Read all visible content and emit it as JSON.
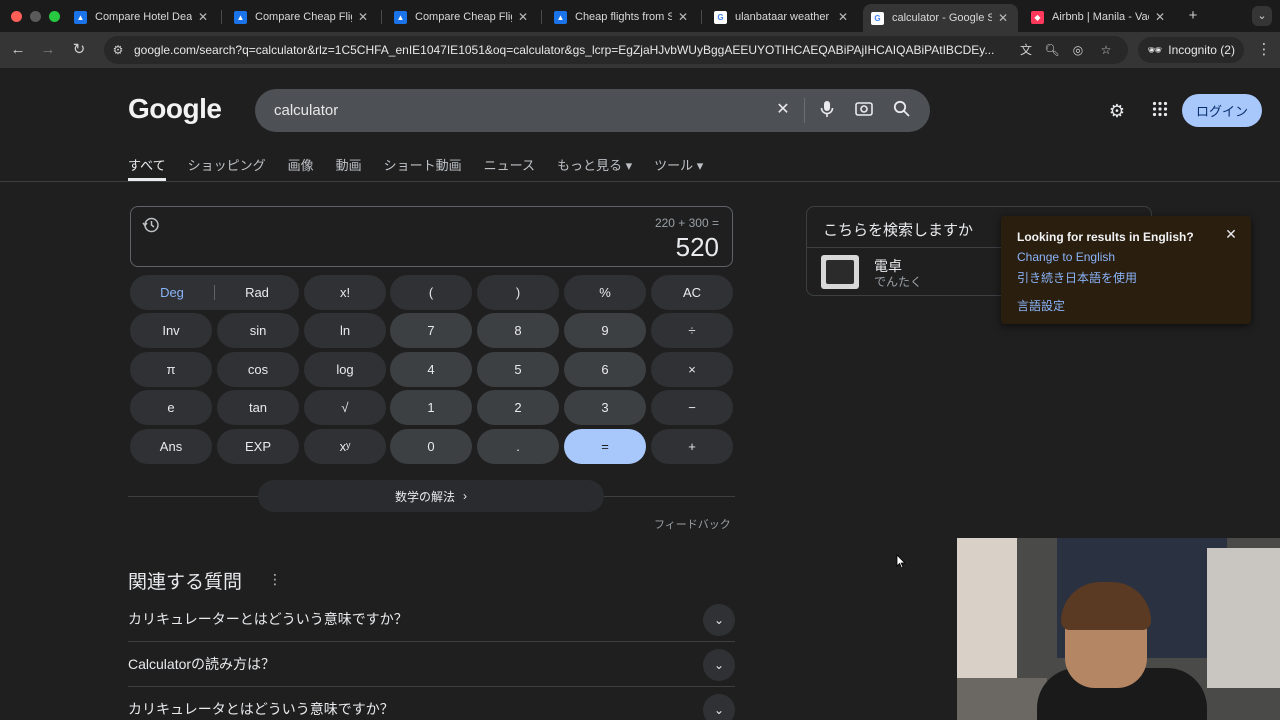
{
  "browser": {
    "tabs": [
      {
        "label": "Compare Hotel Deals",
        "icon": "kayak-icon",
        "color": "#1a73e8"
      },
      {
        "label": "Compare Cheap Flights",
        "icon": "kayak-icon",
        "color": "#1a73e8"
      },
      {
        "label": "Compare Cheap Flights",
        "icon": "kayak-icon",
        "color": "#1a73e8"
      },
      {
        "label": "Cheap flights from S",
        "icon": "kayak-icon",
        "color": "#1a73e8"
      },
      {
        "label": "ulanbataar weather -",
        "icon": "google-icon",
        "color": "#ffffff"
      },
      {
        "label": "calculator - Google S",
        "icon": "google-icon",
        "color": "#ffffff"
      },
      {
        "label": "Airbnb | Manila - Vac",
        "icon": "airbnb-icon",
        "color": "#ff385c"
      }
    ],
    "url": "google.com/search?q=calculator&rlz=1C5CHFA_enIE1047IE1051&oq=calculator&gs_lcrp=EgZjaHJvbWUyBggAEEUYOTIHCAEQABiPAjIHCAIQABiPAtIBCDEy...",
    "incognito_label": "Incognito (2)"
  },
  "google": {
    "logo": "Google",
    "query": "calculator",
    "login_label": "ログイン",
    "nav": [
      "すべて",
      "ショッピング",
      "画像",
      "動画",
      "ショート動画",
      "ニュース",
      "もっと見る ▾",
      "ツール ▾"
    ]
  },
  "calculator": {
    "expression": "220 + 300 =",
    "result": "520",
    "deg": "Deg",
    "rad": "Rad",
    "keys": [
      [
        "x!",
        "(",
        ")",
        "%",
        "AC"
      ],
      [
        "Inv",
        "sin",
        "ln",
        "7",
        "8",
        "9",
        "÷"
      ],
      [
        "π",
        "cos",
        "log",
        "4",
        "5",
        "6",
        "×"
      ],
      [
        "e",
        "tan",
        "√",
        "1",
        "2",
        "3",
        "−"
      ],
      [
        "Ans",
        "EXP",
        "xʸ",
        "0",
        ".",
        "=",
        "+"
      ]
    ],
    "math_button": "数学の解法",
    "feedback": "フィードバック"
  },
  "related": {
    "title": "関連する質問",
    "items": [
      "カリキュレーターとはどういう意味ですか？",
      "Calculatorの読み方は？",
      "カリキュレータとはどういう意味ですか？"
    ]
  },
  "knowledge": {
    "title": "こちらを検索しますか",
    "word": "電卓",
    "reading": "でんたく"
  },
  "popup": {
    "title": "Looking for results in English?",
    "link1": "Change to English",
    "link2": "引き続き日本語を使用",
    "link3": "言語設定"
  }
}
